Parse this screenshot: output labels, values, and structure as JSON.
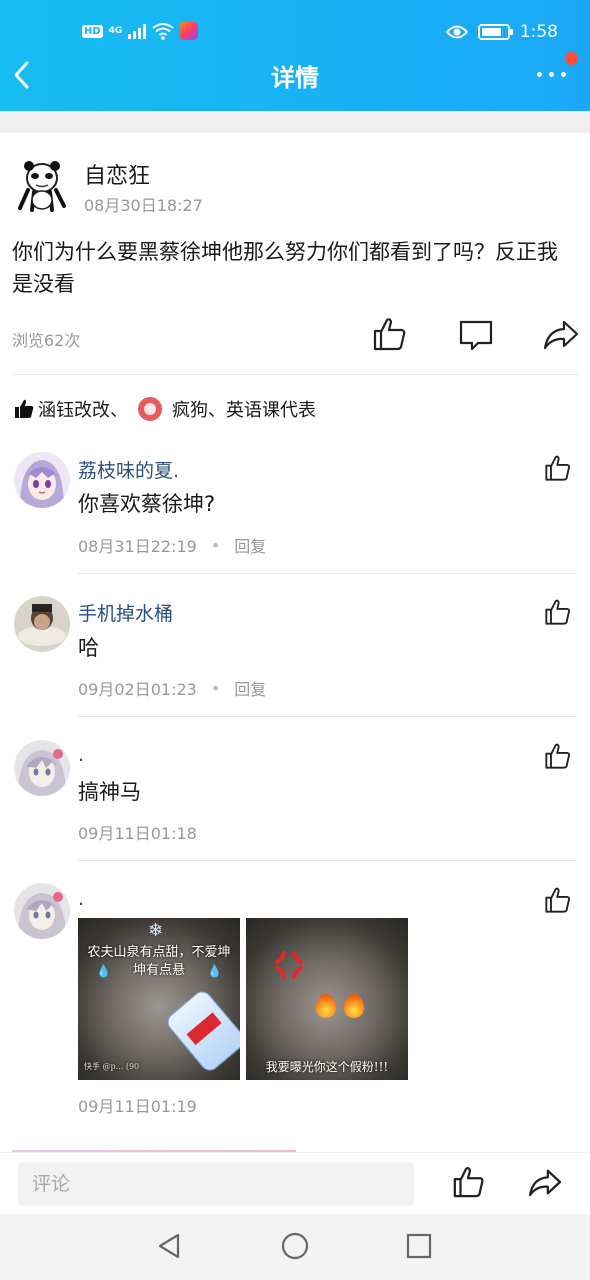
{
  "status_bar": {
    "time": "1:58",
    "hd": "HD",
    "network": "4G"
  },
  "header": {
    "title": "详情"
  },
  "post": {
    "author": "自恋狂",
    "time": "08月30日18:27",
    "content": "你们为什么要黑蔡徐坤他那么努力你们都看到了吗？反正我是没看",
    "views": "浏览62次"
  },
  "likes": {
    "names_before": "涵钰改改、",
    "names_after": "疯狗、英语课代表"
  },
  "comments": [
    {
      "name": "荔枝味的夏.",
      "text": "你喜欢蔡徐坤?",
      "time": "08月31日22:19",
      "reply": "回复"
    },
    {
      "name": "手机掉水桶",
      "text": "哈",
      "time": "09月02日01:23",
      "reply": "回复"
    },
    {
      "name": ".",
      "text": "搞神马",
      "time": "09月11日01:18"
    },
    {
      "name": ".",
      "time": "09月11日01:19",
      "memes": [
        {
          "caption": "农夫山泉有点甜，不爱坤坤有点悬",
          "watermark": "快手 @p... (90"
        },
        {
          "caption": "我要曝光你这个假粉!!!"
        }
      ]
    }
  ],
  "bottom_bar": {
    "comment_placeholder": "评论"
  },
  "colors": {
    "header": "#16bdf2",
    "name_link": "#2c4f7c",
    "muted": "#999999"
  }
}
